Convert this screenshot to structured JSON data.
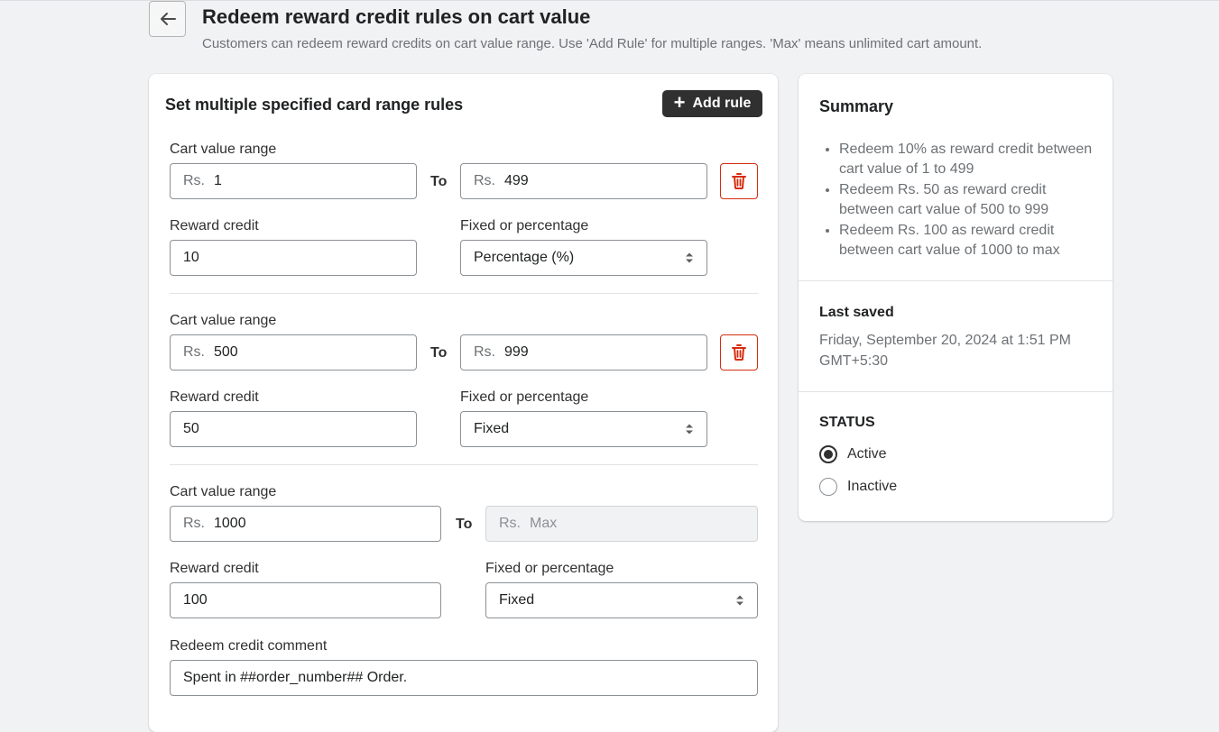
{
  "header": {
    "title": "Redeem reward credit rules on cart value",
    "subtitle": "Customers can redeem reward credits on cart value range. Use 'Add Rule' for multiple ranges. 'Max' means unlimited cart amount."
  },
  "main": {
    "heading": "Set multiple specified card range rules",
    "add_rule_label": "Add rule",
    "rules": [
      {
        "range_label": "Cart value range",
        "prefix": "Rs.",
        "from": "1",
        "to_label": "To",
        "to": "499",
        "reward_label": "Reward credit",
        "reward": "10",
        "type_label": "Fixed or percentage",
        "type": "Percentage (%)"
      },
      {
        "range_label": "Cart value range",
        "prefix": "Rs.",
        "from": "500",
        "to_label": "To",
        "to": "999",
        "reward_label": "Reward credit",
        "reward": "50",
        "type_label": "Fixed or percentage",
        "type": "Fixed"
      },
      {
        "range_label": "Cart value range",
        "prefix": "Rs.",
        "from": "1000",
        "to_label": "To",
        "to_placeholder": "Max",
        "reward_label": "Reward credit",
        "reward": "100",
        "type_label": "Fixed or percentage",
        "type": "Fixed"
      }
    ],
    "comment_label": "Redeem credit comment",
    "comment": "Spent in ##order_number## Order."
  },
  "summary": {
    "heading": "Summary",
    "items": [
      "Redeem 10% as reward credit between cart value of 1 to 499",
      "Redeem Rs. 50 as reward credit between cart value of 500 to 999",
      "Redeem Rs. 100 as reward credit between cart value of 1000 to max"
    ],
    "last_saved_label": "Last saved",
    "last_saved_value": "Friday, September 20, 2024 at 1:51 PM GMT+5:30",
    "status_label": "STATUS",
    "status_options": [
      "Active",
      "Inactive"
    ],
    "status_selected": "Active"
  },
  "colors": {
    "primary_button": "#303030",
    "destructive": "#d72c0d",
    "background": "#f1f2f4"
  }
}
